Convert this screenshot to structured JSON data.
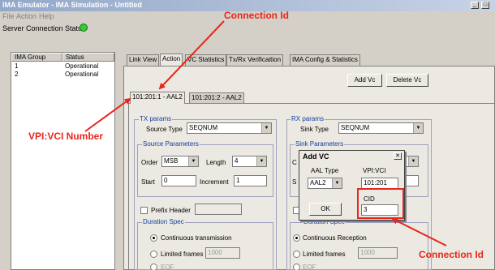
{
  "window": {
    "title": "IMA Emulator - IMA Simulation - Untitled",
    "minimize": "_",
    "maximize": "□"
  },
  "menu": [
    "File",
    "Action",
    "Help"
  ],
  "server_status": {
    "label": "Server Connection Status",
    "color": "#33cc33"
  },
  "group_list": {
    "headers": [
      "IMA Group",
      "Status"
    ],
    "rows": [
      {
        "group": "1",
        "status": "Operational"
      },
      {
        "group": "2",
        "status": "Operational"
      }
    ]
  },
  "main_tabs": [
    "Link View",
    "Action",
    "VC Statistics",
    "Tx/Rx Verificaition",
    "IMA Config & Statistics"
  ],
  "buttons": {
    "add_vc": "Add Vc",
    "delete_vc": "Delete Vc"
  },
  "vc_tabs": [
    "101:201:1 - AAL2",
    "101:201:2 - AAL2"
  ],
  "tx": {
    "legend": "TX params",
    "source_type_label": "Source Type",
    "source_type": "SEQNUM",
    "source_params_legend": "Source Parameters",
    "order_label": "Order",
    "order": "MSB",
    "length_label": "Length",
    "length": "4",
    "start_label": "Start",
    "start": "0",
    "increment_label": "Increment",
    "increment": "1",
    "prefix_header_label": "Prefix Header",
    "duration_legend": "Duration Spec",
    "continuous_label": "Continuous transmission",
    "limited_label": "Limited frames",
    "limited_value": "1000",
    "eof_label": "EOF"
  },
  "rx": {
    "legend": "RX params",
    "sink_type_label": "Sink Type",
    "sink_type": "SEQNUM",
    "sink_params_legend": "Sink Parameters",
    "c_label": "C",
    "s_label": "S",
    "duration_legend": "Duration Spec",
    "continuous_label": "Continuous Reception",
    "limited_label": "Limited frames",
    "limited_value": "1000",
    "eof_label": "EOF"
  },
  "dialog": {
    "title": "Add VC",
    "close": "✕",
    "aal_type_label": "AAL Type",
    "aal_type": "AAL2",
    "vpivci_label": "VPI:VCI",
    "vpivci": "101:201",
    "cid_label": "CID",
    "cid": "3",
    "ok": "OK"
  },
  "annotations": {
    "connection_id_top": "Connection Id",
    "vpivci_number": "VPI:VCI Number",
    "connection_id_bottom": "Connection Id",
    "color": "#e8261c"
  }
}
